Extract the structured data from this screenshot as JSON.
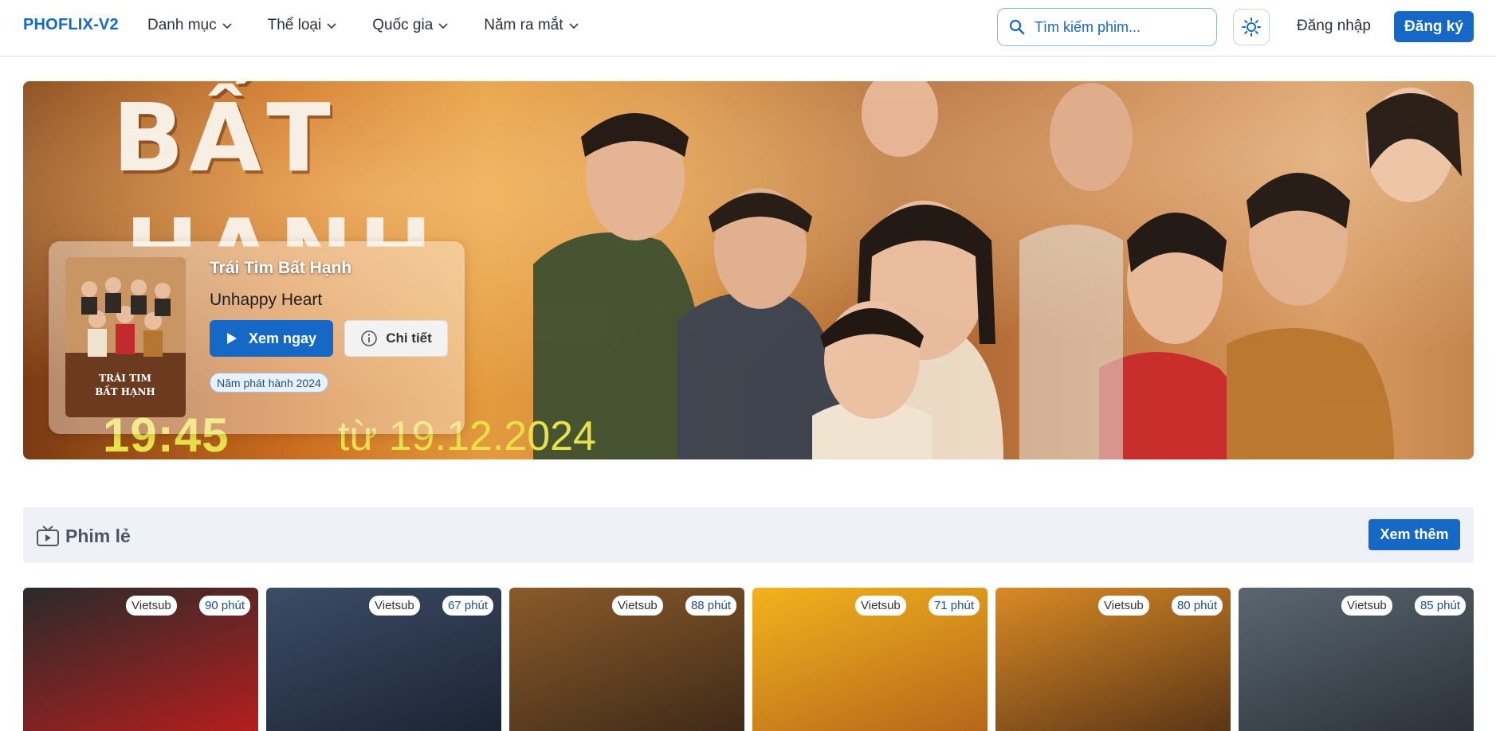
{
  "header": {
    "logo": "PHOFLIX-V2",
    "nav": [
      "Danh mục",
      "Thể loại",
      "Quốc gia",
      "Năm ra mắt"
    ],
    "search_placeholder": "Tìm kiếm phim...",
    "login": "Đăng nhập",
    "register": "Đăng ký"
  },
  "hero": {
    "artwork_title_top": "BẤT",
    "artwork_title_bottom": "HẠNH",
    "artwork_time": "19:45",
    "artwork_date": "từ 19.12.2024",
    "poster_line1": "TRÁI TIM",
    "poster_line2": "BẤT HẠNH",
    "title": "Trái Tim Bất Hạnh",
    "subtitle": "Unhappy Heart",
    "watch_label": "Xem ngay",
    "detail_label": "Chi tiết",
    "year_badge": "Năm phát hành 2024",
    "slides": 9,
    "active_slide": 2
  },
  "section": {
    "title": "Phim lẻ",
    "more_label": "Xem thêm"
  },
  "movies": [
    {
      "lang": "Vietsub",
      "duration": "90 phút",
      "colors": [
        "#2a2a2a",
        "#b41e1e"
      ]
    },
    {
      "lang": "Vietsub",
      "duration": "67 phút",
      "colors": [
        "#3c4c66",
        "#1b2433"
      ]
    },
    {
      "lang": "Vietsub",
      "duration": "88 phút",
      "colors": [
        "#8a5a2a",
        "#3f2a18"
      ]
    },
    {
      "lang": "Vietsub",
      "duration": "71 phút",
      "colors": [
        "#f1b31c",
        "#b6661b"
      ]
    },
    {
      "lang": "Vietsub",
      "duration": "80 phút",
      "colors": [
        "#d98a25",
        "#5a3516"
      ]
    },
    {
      "lang": "Vietsub",
      "duration": "85 phút",
      "colors": [
        "#5a6670",
        "#2b3238"
      ]
    }
  ],
  "colors": {
    "accent": "#1668c7",
    "section_bg": "#eef2f7"
  }
}
